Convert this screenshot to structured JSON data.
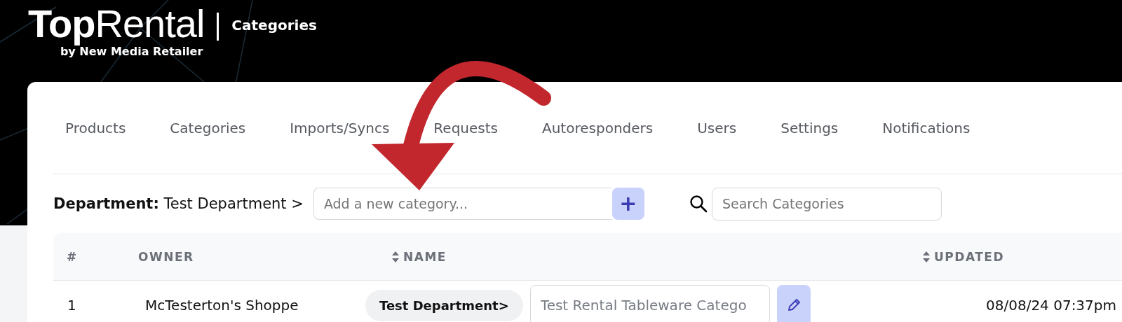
{
  "header": {
    "logo": "**Top**Rental",
    "tagline": "by New Media Retailer",
    "page_title": "Categories"
  },
  "tabs": [
    {
      "label": "Products",
      "selected": false
    },
    {
      "label": "Categories",
      "selected": false
    },
    {
      "label": "Imports/Syncs",
      "selected": false
    },
    {
      "label": "Requests",
      "selected": false
    },
    {
      "label": "Autoresponders",
      "selected": false
    },
    {
      "label": "Users",
      "selected": false
    },
    {
      "label": "Settings",
      "selected": false
    },
    {
      "label": "Notifications",
      "selected": false
    }
  ],
  "breadcrumb": {
    "label": "Department:",
    "value": "Test Department >"
  },
  "new_category": {
    "placeholder": "Add a new category...",
    "add_button": "+"
  },
  "search": {
    "placeholder": "Search Categories"
  },
  "table": {
    "columns": [
      {
        "label": "#",
        "sortable": false
      },
      {
        "label": "OWNER",
        "sortable": false
      },
      {
        "label": "NAME",
        "sortable": true
      },
      {
        "label": "UPDATED",
        "sortable": true
      }
    ],
    "rows": [
      {
        "number": "1",
        "owner": "McTesterton's Shoppe",
        "department": "Test Department>",
        "name": "Test Rental Tableware Catego",
        "updated": "08/08/24 07:37pm"
      }
    ]
  }
}
